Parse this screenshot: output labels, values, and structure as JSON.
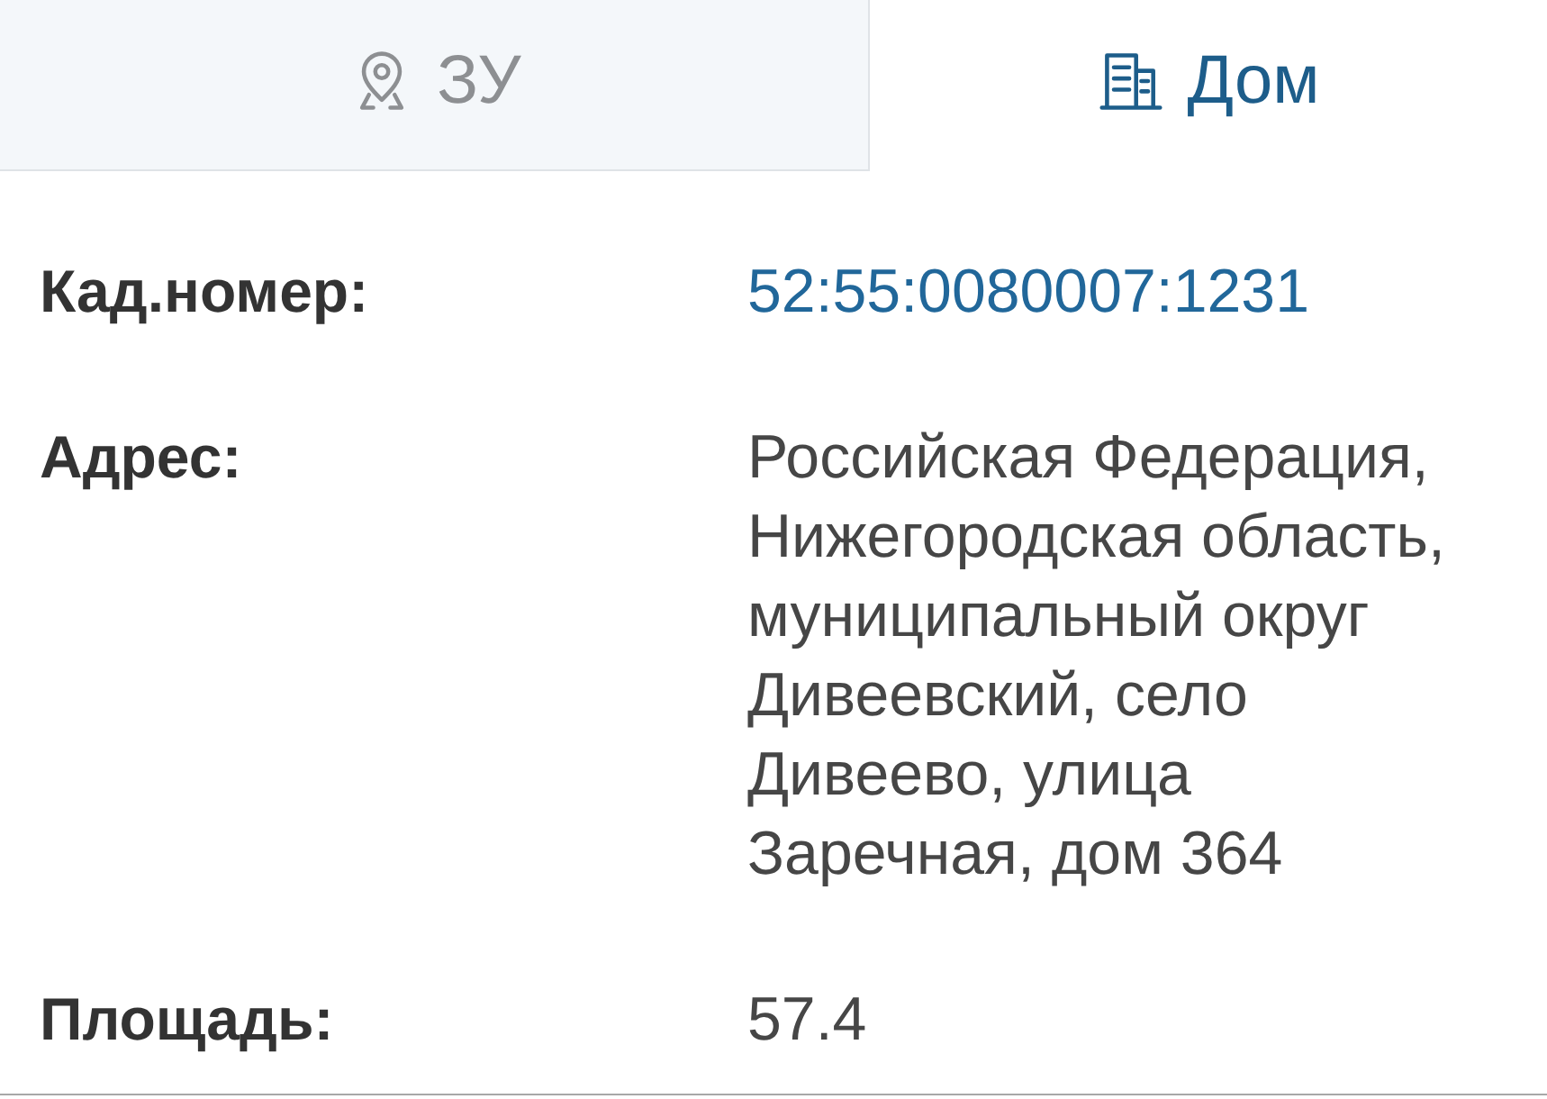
{
  "tabs": [
    {
      "label": "ЗУ",
      "kind": "plot",
      "selected": false
    },
    {
      "label": "Дом",
      "kind": "building",
      "selected": true
    }
  ],
  "fields": [
    {
      "label": "Кад.номер:",
      "value": "52:55:0080007:1231",
      "kind": "link"
    },
    {
      "label": "Адрес:",
      "value": "Российская Федерация, Нижегородская область, муниципальный округ Дивеевский, село Дивеево, улица Заречная, дом 364",
      "kind": "text"
    },
    {
      "label": "Площадь:",
      "value": "57.4",
      "kind": "text"
    }
  ]
}
